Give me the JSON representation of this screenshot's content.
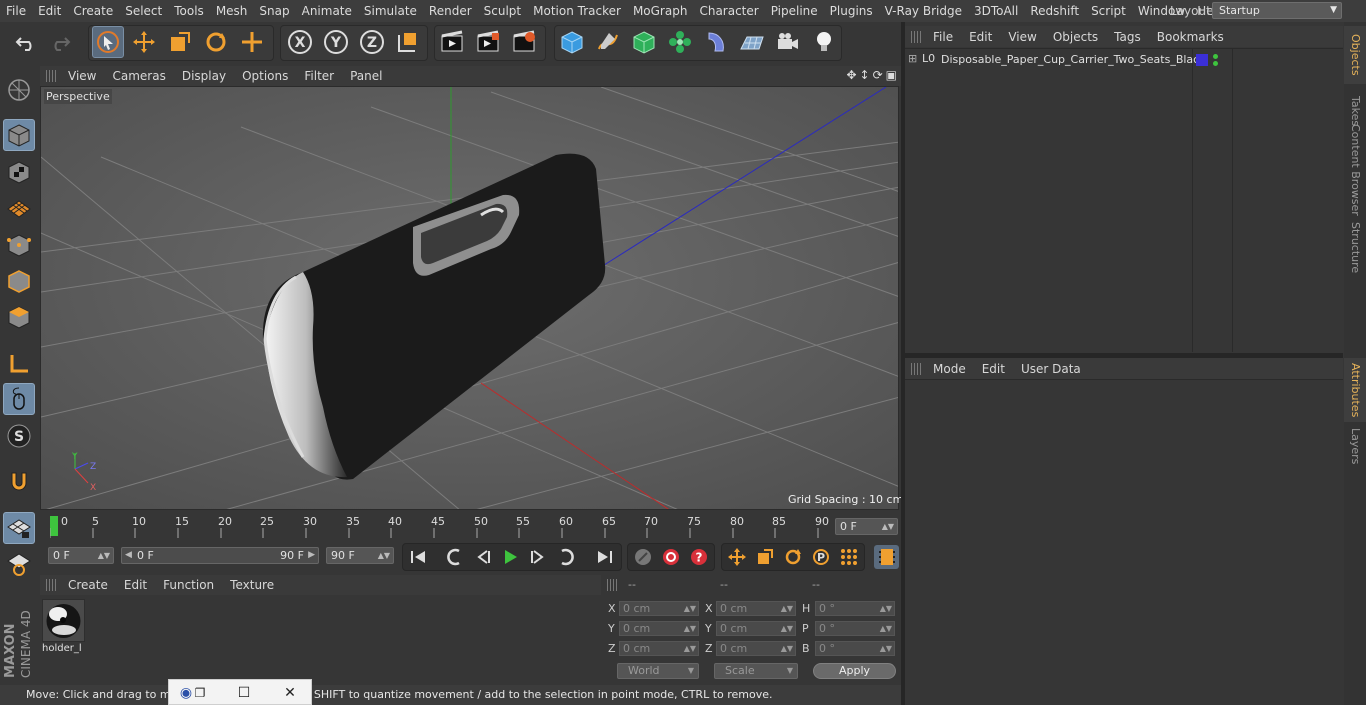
{
  "menubar": {
    "items": [
      "File",
      "Edit",
      "Create",
      "Select",
      "Tools",
      "Mesh",
      "Snap",
      "Animate",
      "Simulate",
      "Render",
      "Sculpt",
      "Motion Tracker",
      "MoGraph",
      "Character",
      "Pipeline",
      "Plugins",
      "V-Ray Bridge",
      "3DToAll",
      "Redshift",
      "Script",
      "Window",
      "Help"
    ],
    "layout_label": "Layout:",
    "layout_value": "Startup"
  },
  "toolbar": {
    "icons": [
      "undo-icon",
      "redo-icon",
      "live-selection-icon",
      "move-icon",
      "scale-icon",
      "rotate-icon",
      "recent-tools-icon",
      "x-axis-lock-icon",
      "y-axis-lock-icon",
      "z-axis-lock-icon",
      "coordinate-system-icon",
      "render-view-icon",
      "render-to-picture-viewer-icon",
      "render-settings-icon",
      "cube-primitive-icon",
      "pen-spline-icon",
      "subdivision-surface-icon",
      "cloner-icon",
      "deformer-icon",
      "floor-icon",
      "camera-icon",
      "light-icon"
    ],
    "axis_labels": [
      "X",
      "Y",
      "Z"
    ]
  },
  "lefttools": {
    "icons": [
      "make-editable-icon",
      "model-mode-icon",
      "texture-mode-icon",
      "workplane-icon",
      "points-mode-icon",
      "edges-mode-icon",
      "polygons-mode-icon",
      "axis-mode-icon",
      "tweak-mode-icon",
      "solo-icon",
      "snap-icon",
      "workplane-lock-icon",
      "animation-mode-icon"
    ],
    "solo_letter": "S",
    "brand_line1": "MAXON",
    "brand_line2": "CINEMA 4D"
  },
  "viewport": {
    "menu": [
      "View",
      "Cameras",
      "Display",
      "Options",
      "Filter",
      "Panel"
    ],
    "camera_label": "Perspective",
    "grid_spacing": "Grid Spacing : 10 cm",
    "axis_labels": [
      "Y",
      "Z",
      "X"
    ]
  },
  "timeline": {
    "ticks": [
      "0",
      "5",
      "10",
      "15",
      "20",
      "25",
      "30",
      "35",
      "40",
      "45",
      "50",
      "55",
      "60",
      "65",
      "70",
      "75",
      "80",
      "85",
      "90"
    ],
    "current_frame": "0 F",
    "start_frame": "0 F",
    "range_start": "0 F",
    "range_end": "90 F",
    "end_frame": "90 F"
  },
  "playback": {
    "buttons": [
      "go-to-start-icon",
      "previous-key-icon",
      "play-backwards-icon",
      "play-forwards-icon",
      "next-key-icon",
      "next-frame-icon",
      "go-to-end-icon",
      "record-keys-icon",
      "auto-keying-icon",
      "keyframe-selection-icon",
      "position-key-icon",
      "scale-key-icon",
      "rotation-key-icon",
      "parameter-key-icon",
      "point-level-anim-icon",
      "timeline-icon"
    ],
    "param_letter": "P"
  },
  "materials": {
    "menu": [
      "Create",
      "Edit",
      "Function",
      "Texture"
    ],
    "items": [
      {
        "name": "holder_l"
      }
    ]
  },
  "coordinates": {
    "headers": [
      "--",
      "--",
      "--"
    ],
    "rows": [
      {
        "l1": "X",
        "v1": "0 cm",
        "l2": "X",
        "v2": "0 cm",
        "l3": "H",
        "v3": "0 °"
      },
      {
        "l1": "Y",
        "v1": "0 cm",
        "l2": "Y",
        "v2": "0 cm",
        "l3": "P",
        "v3": "0 °"
      },
      {
        "l1": "Z",
        "v1": "0 cm",
        "l2": "Z",
        "v2": "0 cm",
        "l3": "B",
        "v3": "0 °"
      }
    ],
    "space": "World",
    "mode": "Scale",
    "apply": "Apply"
  },
  "status": {
    "text": "Move: Click and drag to move elements. Hold down SHIFT to quantize movement / add to the selection in point mode, CTRL to remove."
  },
  "objects": {
    "menu": [
      "File",
      "Edit",
      "View",
      "Objects",
      "Tags",
      "Bookmarks"
    ],
    "tree": [
      {
        "name": "Disposable_Paper_Cup_Carrier_Two_Seats_Black",
        "layer_color": "#3b2fd6"
      }
    ]
  },
  "attributes": {
    "menu": [
      "Mode",
      "Edit",
      "User Data"
    ]
  },
  "righttabs": [
    "Objects",
    "Takes",
    "Content Browser",
    "Structure",
    "Attributes",
    "Layers"
  ],
  "colors": {
    "accent": "#e6b35a",
    "selected": "#6e8aa6",
    "play": "#3ec43e"
  }
}
